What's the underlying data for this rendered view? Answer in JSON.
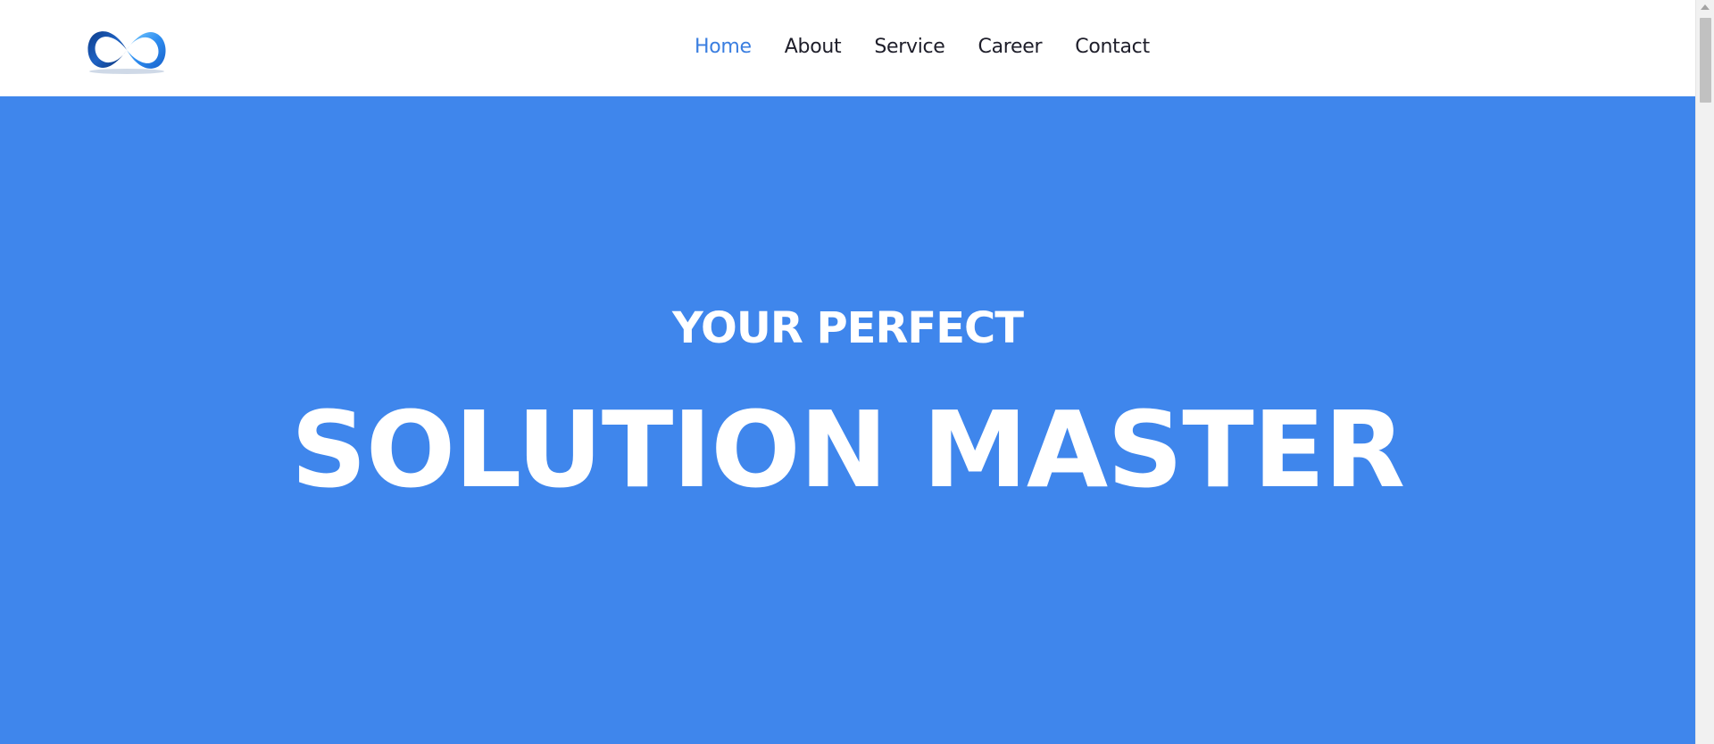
{
  "header": {
    "logo_icon": "infinity-logo-icon",
    "nav": [
      {
        "label": "Home",
        "active": true
      },
      {
        "label": "About",
        "active": false
      },
      {
        "label": "Service",
        "active": false
      },
      {
        "label": "Career",
        "active": false
      },
      {
        "label": "Contact",
        "active": false
      }
    ]
  },
  "hero": {
    "subtitle": "YOUR PERFECT",
    "title": "SOLUTION MASTER"
  },
  "colors": {
    "accent": "#3a7ee0",
    "hero_background": "#3f86ec",
    "nav_text": "#1e1e2a"
  },
  "scrollbar": {
    "up_icon": "scroll-up-arrow-icon"
  }
}
